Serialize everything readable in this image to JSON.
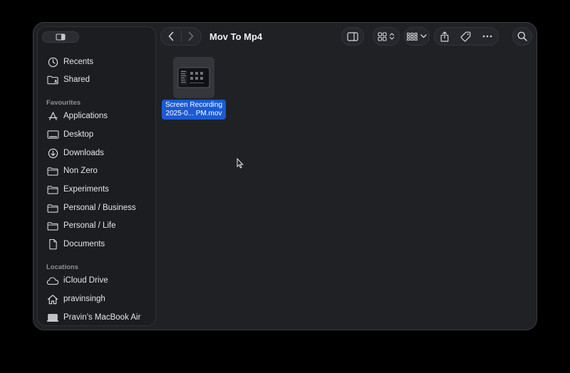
{
  "window": {
    "title": "Mov To Mp4"
  },
  "sidebar": {
    "items_top": [
      {
        "label": "Recents",
        "icon": "clock-icon"
      },
      {
        "label": "Shared",
        "icon": "shared-folder-icon"
      }
    ],
    "favourites_heading": "Favourites",
    "favourites": [
      {
        "label": "Applications",
        "icon": "applications-icon"
      },
      {
        "label": "Desktop",
        "icon": "desktop-icon"
      },
      {
        "label": "Downloads",
        "icon": "download-icon"
      },
      {
        "label": "Non Zero",
        "icon": "folder-icon"
      },
      {
        "label": "Experiments",
        "icon": "folder-icon"
      },
      {
        "label": "Personal / Business",
        "icon": "folder-icon"
      },
      {
        "label": "Personal / Life",
        "icon": "folder-icon"
      },
      {
        "label": "Documents",
        "icon": "document-icon"
      }
    ],
    "locations_heading": "Locations",
    "locations": [
      {
        "label": "iCloud Drive",
        "icon": "cloud-icon"
      },
      {
        "label": "pravinsingh",
        "icon": "home-icon"
      },
      {
        "label": "Pravin’s MacBook Air",
        "icon": "laptop-icon"
      }
    ]
  },
  "file": {
    "name_line1": "Screen Recording",
    "name_line2": "2025-0... PM.mov"
  },
  "colors": {
    "selection": "#1a5bd6",
    "window_bg": "#1f2125",
    "sidebar_bg": "#1b1d21"
  }
}
